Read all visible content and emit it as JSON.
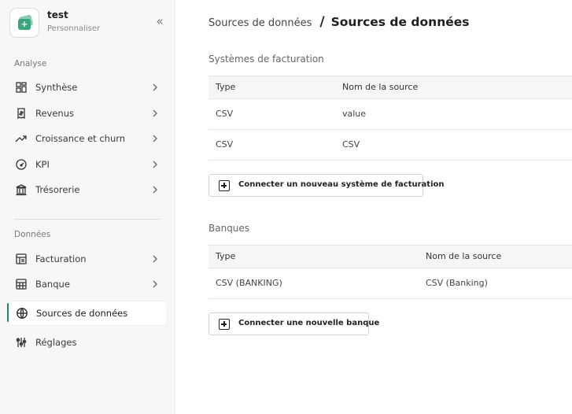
{
  "workspace": {
    "name": "test",
    "subtitle": "Personnaliser",
    "collapse_glyph": "«"
  },
  "sidebar": {
    "analyse_label": "Analyse",
    "donnees_label": "Données",
    "items": [
      {
        "label": "Synthèse",
        "icon": "grid-icon"
      },
      {
        "label": "Revenus",
        "icon": "receipt-icon"
      },
      {
        "label": "Croissance et churn",
        "icon": "trend-up-icon"
      },
      {
        "label": "KPI",
        "icon": "gauge-icon"
      },
      {
        "label": "Trésorerie",
        "icon": "bank-icon"
      },
      {
        "label": "Facturation",
        "icon": "invoice-icon"
      },
      {
        "label": "Banque",
        "icon": "building-icon"
      },
      {
        "label": "Sources de données",
        "icon": "globe-icon",
        "active": true
      },
      {
        "label": "Réglages",
        "icon": "sliders-icon"
      }
    ]
  },
  "breadcrumb": {
    "parent": "Sources de données",
    "separator": "/",
    "current": "Sources de données"
  },
  "billing": {
    "title": "Systèmes de facturation",
    "headers": [
      "Type",
      "Nom de la source"
    ],
    "rows": [
      [
        "CSV",
        "value"
      ],
      [
        "CSV",
        "CSV"
      ]
    ],
    "button_label": "Connecter un nouveau système de facturation"
  },
  "banks": {
    "title": "Banques",
    "headers": [
      "Type",
      "Nom de la source"
    ],
    "rows": [
      [
        "CSV (BANKING)",
        "CSV (Banking)"
      ]
    ],
    "button_label": "Connecter une nouvelle banque"
  },
  "colors": {
    "accent": "#1f8b63",
    "logo_green": "#3aa57b",
    "sidebar_bg": "#f7f7f7"
  }
}
